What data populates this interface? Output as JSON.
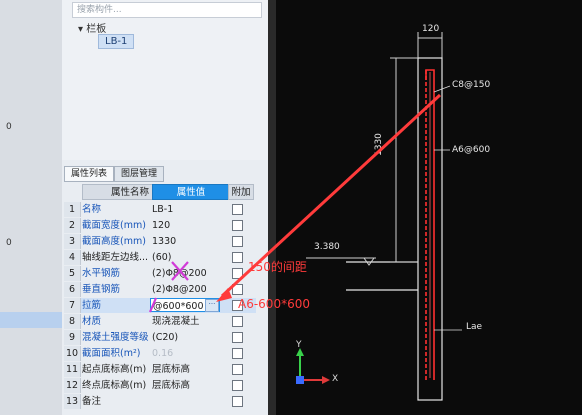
{
  "left_edge": {
    "numbers": [
      "0",
      "0"
    ]
  },
  "tree": {
    "search_placeholder": "搜索构件...",
    "root_label": "栏板",
    "child_label": "LB-1"
  },
  "tabs": {
    "properties": "属性列表",
    "layers": "图层管理"
  },
  "table": {
    "headers": {
      "name": "属性名称",
      "value": "属性值",
      "add": "附加"
    },
    "rows": [
      {
        "n": "1",
        "label": "名称",
        "value": "LB-1",
        "label_style": "blue"
      },
      {
        "n": "2",
        "label": "截面宽度(mm)",
        "value": "120",
        "label_style": "blue"
      },
      {
        "n": "3",
        "label": "截面高度(mm)",
        "value": "1330",
        "label_style": "blue"
      },
      {
        "n": "4",
        "label": "轴线距左边线...",
        "value": "(60)",
        "label_style": "dark"
      },
      {
        "n": "5",
        "label": "水平钢筋",
        "value": "(2)Φ8@200",
        "label_style": "blue"
      },
      {
        "n": "6",
        "label": "垂直钢筋",
        "value": "(2)Φ8@200",
        "label_style": "blue"
      },
      {
        "n": "7",
        "label": "拉筋",
        "value": "@600*600",
        "label_style": "blue"
      },
      {
        "n": "8",
        "label": "材质",
        "value": "现浇混凝土",
        "label_style": "blue"
      },
      {
        "n": "9",
        "label": "混凝土强度等级",
        "value": "(C20)",
        "label_style": "blue"
      },
      {
        "n": "10",
        "label": "截面面积(m²)",
        "value": "0.16",
        "label_style": "blue"
      },
      {
        "n": "11",
        "label": "起点底标高(m)",
        "value": "层底标高",
        "label_style": "dark"
      },
      {
        "n": "12",
        "label": "终点底标高(m)",
        "value": "层底标高",
        "label_style": "dark"
      },
      {
        "n": "13",
        "label": "备注",
        "value": "",
        "label_style": "dark"
      }
    ],
    "dots_button": "···"
  },
  "cad": {
    "dim_width": "120",
    "rebar_top": "C8@150",
    "rebar_mid": "A6@600",
    "dim_height": "1330",
    "elevation": "3.380",
    "lae": "Lae",
    "axis_y": "Y",
    "axis_x": "X"
  },
  "annotations": {
    "spacing_note": "150的间距",
    "tie_note": "A6-600*600",
    "color": "#ff3b3b",
    "mark_color": "#d23bd8"
  }
}
